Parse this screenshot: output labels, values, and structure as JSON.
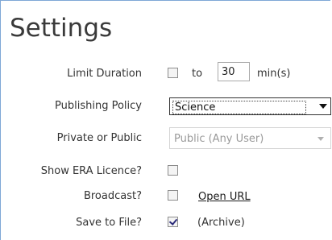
{
  "panel": {
    "title": "Settings"
  },
  "limit_duration": {
    "label": "Limit Duration",
    "checked": false,
    "to_text": "to",
    "value": "30",
    "unit": "min(s)"
  },
  "publishing_policy": {
    "label": "Publishing Policy",
    "selected": "Science"
  },
  "private_public": {
    "label": "Private or Public",
    "selected": "Public (Any User)",
    "disabled": true
  },
  "show_era": {
    "label": "Show ERA Licence?",
    "checked": false
  },
  "broadcast": {
    "label": "Broadcast?",
    "checked": false,
    "link": "Open URL"
  },
  "save_to_file": {
    "label": "Save to File?",
    "checked": true,
    "note": "(Archive)"
  }
}
